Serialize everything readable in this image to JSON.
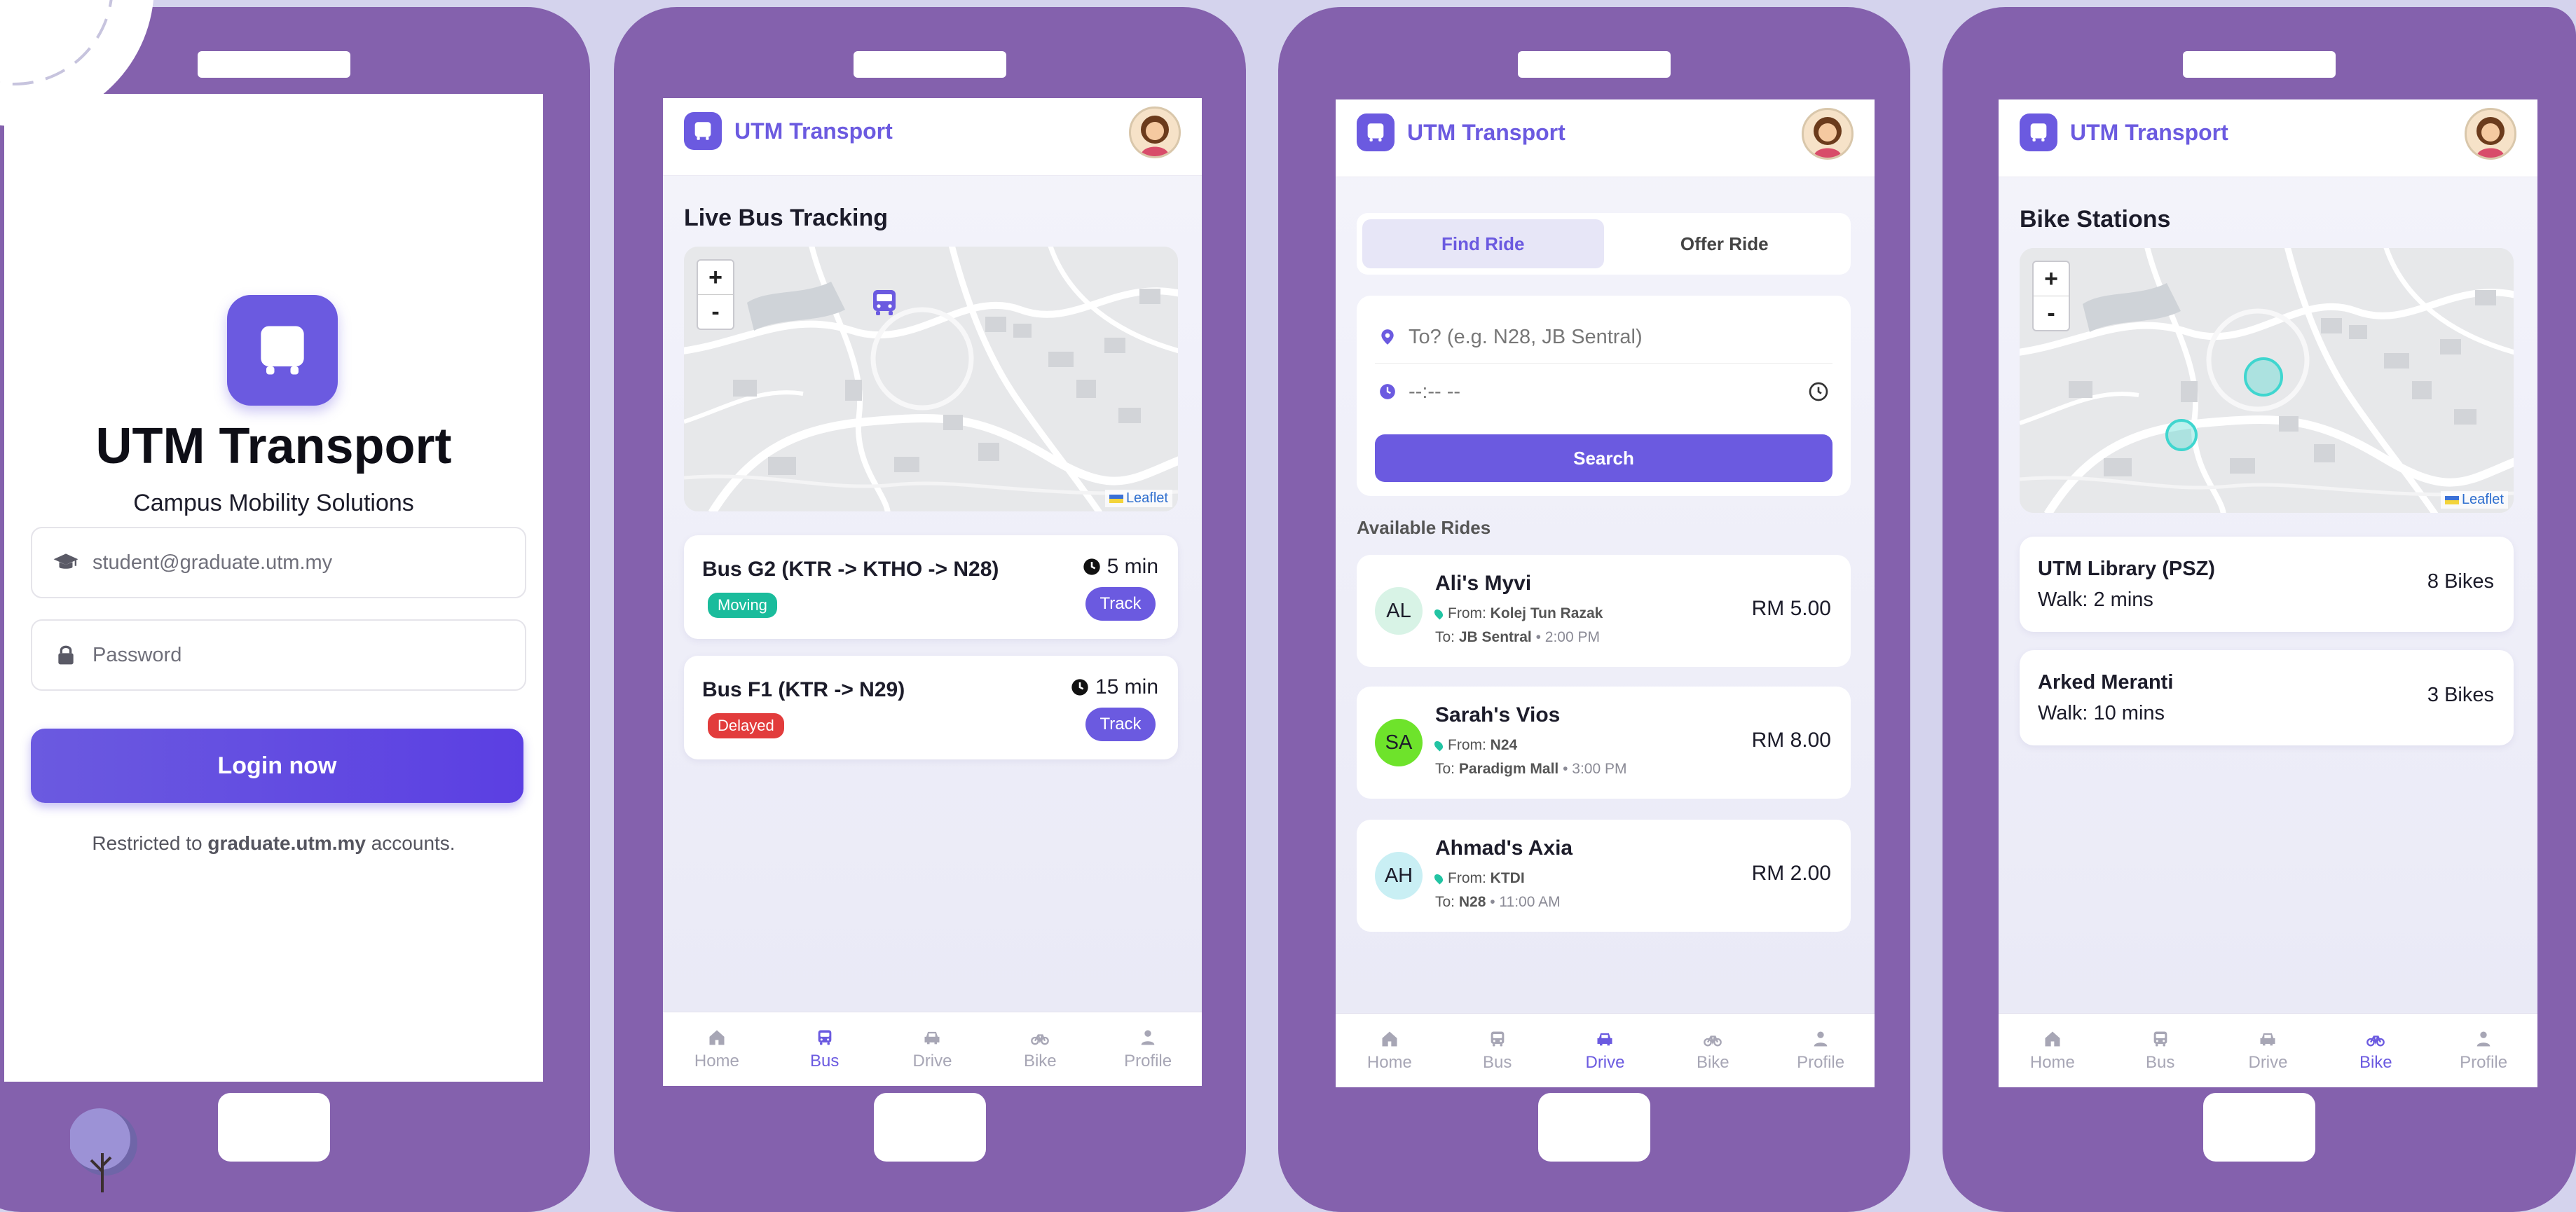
{
  "colors": {
    "accent": "#6b5ae0",
    "frame": "#8461ad",
    "moving": "#1abc9c",
    "delayed": "#e23c3c",
    "bike_marker": "#3fd6cf"
  },
  "nav": [
    {
      "label": "Home",
      "icon": "home-icon"
    },
    {
      "label": "Bus",
      "icon": "bus-icon"
    },
    {
      "label": "Drive",
      "icon": "car-icon"
    },
    {
      "label": "Bike",
      "icon": "bike-icon"
    },
    {
      "label": "Profile",
      "icon": "person-icon"
    }
  ],
  "app": {
    "name": "UTM Transport"
  },
  "login": {
    "title": "UTM Transport",
    "subtitle": "Campus Mobility Solutions",
    "email_placeholder": "student@graduate.utm.my",
    "password_placeholder": "Password",
    "button": "Login now",
    "restrict_prefix": "Restricted to",
    "restrict_domain": "graduate.utm.my",
    "restrict_suffix": "accounts."
  },
  "bus": {
    "title": "Live Bus Tracking",
    "map_attribution": "Leaflet",
    "zoom_in": "+",
    "zoom_out": "-",
    "routes": [
      {
        "name": "Bus G2 (KTR -> KTHO -> N28)",
        "status": "Moving",
        "eta": "5 min",
        "action": "Track"
      },
      {
        "name": "Bus F1 (KTR -> N29)",
        "status": "Delayed",
        "eta": "15 min",
        "action": "Track"
      }
    ]
  },
  "ride": {
    "tab_find": "Find Ride",
    "tab_offer": "Offer Ride",
    "destination_placeholder": "To? (e.g. N28, JB Sentral)",
    "time_placeholder": "--:-- --",
    "search_button": "Search",
    "available_title": "Available Rides",
    "from_label": "From:",
    "to_label": "To:",
    "rides": [
      {
        "initials": "AL",
        "name": "Ali's Myvi",
        "from": "Kolej Tun Razak",
        "to": "JB Sentral",
        "time": "2:00 PM",
        "price": "RM 5.00",
        "avatar_color": "#d8f3e6"
      },
      {
        "initials": "SA",
        "name": "Sarah's Vios",
        "from": "N24",
        "to": "Paradigm Mall",
        "time": "3:00 PM",
        "price": "RM 8.00",
        "avatar_color": "#6ee32b"
      },
      {
        "initials": "AH",
        "name": "Ahmad's Axia",
        "from": "KTDI",
        "to": "N28",
        "time": "11:00 AM",
        "price": "RM 2.00",
        "avatar_color": "#c9eff4"
      }
    ]
  },
  "bike": {
    "title": "Bike Stations",
    "map_attribution": "Leaflet",
    "zoom_in": "+",
    "zoom_out": "-",
    "stations": [
      {
        "name": "UTM Library (PSZ)",
        "walk": "Walk: 2 mins",
        "bikes": "8 Bikes"
      },
      {
        "name": "Arked Meranti",
        "walk": "Walk: 10 mins",
        "bikes": "3 Bikes"
      }
    ]
  }
}
